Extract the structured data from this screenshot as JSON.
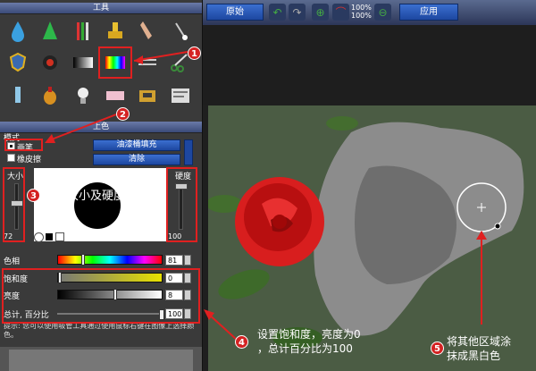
{
  "panels": {
    "tools_title": "工具",
    "color_title": "上色"
  },
  "mode": {
    "label": "模式",
    "brush_label": "画笔",
    "eraser_label": "橡皮擦",
    "fill_button": "油漆桶填充",
    "clear_button": "清除"
  },
  "size": {
    "label": "大小",
    "value": "72"
  },
  "hardness": {
    "label": "硬度",
    "value": "100"
  },
  "sliders": {
    "hue_label": "色相",
    "hue_value": "81",
    "saturation_label": "饱和度",
    "saturation_value": "0",
    "brightness_label": "亮度",
    "brightness_value": "8",
    "total_label": "总计, 百分比",
    "total_value": "100"
  },
  "tip": "提示: 您可以使用吸管工具通过使用鼠标右键在图像上选择颜色。",
  "toolbar": {
    "original_button": "原始",
    "apply_button": "应用",
    "zoom_top": "100%",
    "zoom_bottom": "100%"
  },
  "annotations": {
    "n1": "1",
    "n2": "2",
    "n3": "3",
    "n4": "4",
    "n5": "5",
    "a3": "设置大小及硬度",
    "a4_line1": "设置饱和度，亮度为0",
    "a4_line2": "，总计百分比为100",
    "a5_line1": "将其他区域涂",
    "a5_line2": "抹成黑白色"
  },
  "colors": {
    "accent_red": "#e02020",
    "button_blue": "#2a5bc0",
    "panel_bg": "#3a3a3a"
  }
}
